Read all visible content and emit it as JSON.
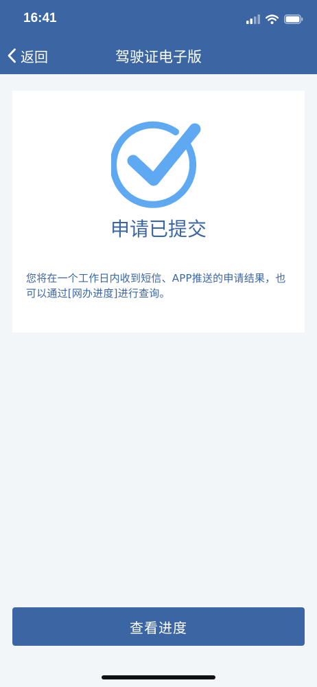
{
  "status_bar": {
    "time": "16:41",
    "signal_icon": "cellular-signal-icon",
    "wifi_icon": "wifi-icon",
    "battery_icon": "battery-icon"
  },
  "nav": {
    "back_icon": "chevron-left-icon",
    "back_label": "返回",
    "title": "驾驶证电子版"
  },
  "result": {
    "icon": "check-circle-icon",
    "title": "申请已提交",
    "description": "您将在一个工作日内收到短信、APP推送的申请结果，也可以通过[网办进度]进行查询。"
  },
  "footer": {
    "button_label": "查看进度"
  },
  "colors": {
    "brand": "#3b66a3",
    "check_accent": "#5fa8f2",
    "background": "#f3f6f8",
    "card": "#ffffff"
  }
}
